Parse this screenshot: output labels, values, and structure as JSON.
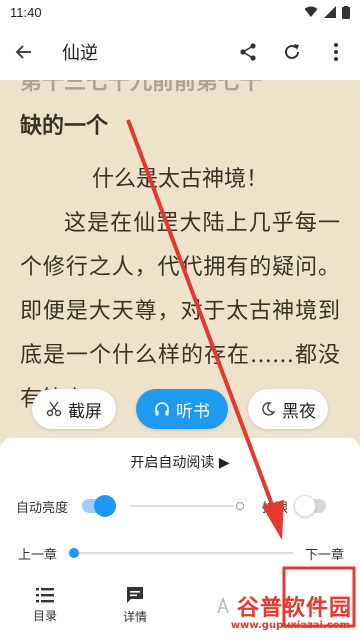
{
  "status_bar": {
    "time": "11:40"
  },
  "app_bar": {
    "title": "仙逆"
  },
  "content": {
    "faded_line": "第十三七十九前前第七十",
    "line_bold": "缺的一个",
    "heading": "什么是太古神境！",
    "paragraph": "这是在仙罡大陆上几乎每一个修行之人，代代拥有的疑问。即便是大天尊，对于太古神境到底是一个什么样的存在……都没有答案"
  },
  "chips": {
    "screenshot": "截屏",
    "listen": "听书",
    "night": "黑夜"
  },
  "panel": {
    "auto_read": "开启自动阅读 ▶",
    "brightness_label": "自动亮度",
    "eye_label": "护眼",
    "prev_chapter": "上一章",
    "next_chapter": "下一章",
    "nav": {
      "catalog": "目录",
      "details": "详情"
    }
  },
  "settings": {
    "auto_brightness_on": true,
    "eye_protect_on": false,
    "chapter_progress": 0.0
  },
  "watermark": {
    "title": "谷普软件园",
    "url": "www.gupuxiazai.com"
  },
  "colors": {
    "accent": "#2196f3",
    "page_bg": "#ece3ca",
    "annotation_red": "#e23a2e"
  }
}
